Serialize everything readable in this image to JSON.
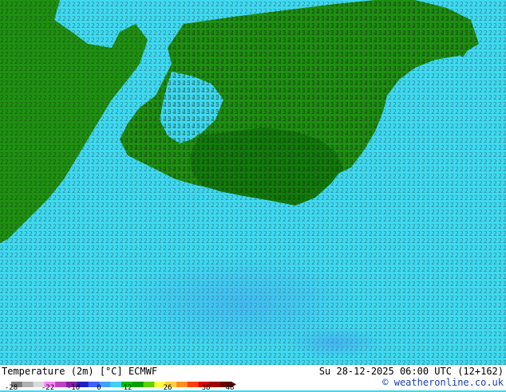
{
  "header": {
    "title": "Temperature (2m) [°C] ECMWF",
    "datetime": "Su 28-12-2025 06:00 UTC (12+162)",
    "credit": "© weatheronline.co.uk"
  },
  "legend": {
    "ticks": [
      "-28",
      "-22",
      "-10",
      "0",
      "12",
      "26",
      "38",
      "48"
    ],
    "colors": [
      "#7a7a7a",
      "#b0b0b0",
      "#d9d9d9",
      "#ff80ff",
      "#c040c0",
      "#8020a0",
      "#2020c0",
      "#4060ff",
      "#40a0ff",
      "#40d0ff",
      "#00c000",
      "#00a000",
      "#60d000",
      "#ffff40",
      "#ffd040",
      "#ff9020",
      "#ff4010",
      "#e00000",
      "#a00000",
      "#600000"
    ]
  },
  "map": {
    "colors": {
      "sea": "#3fd9f0",
      "land": "#1f8f12",
      "land_dark": "#137a0c",
      "cold_patch": "#5aa0f5"
    }
  }
}
